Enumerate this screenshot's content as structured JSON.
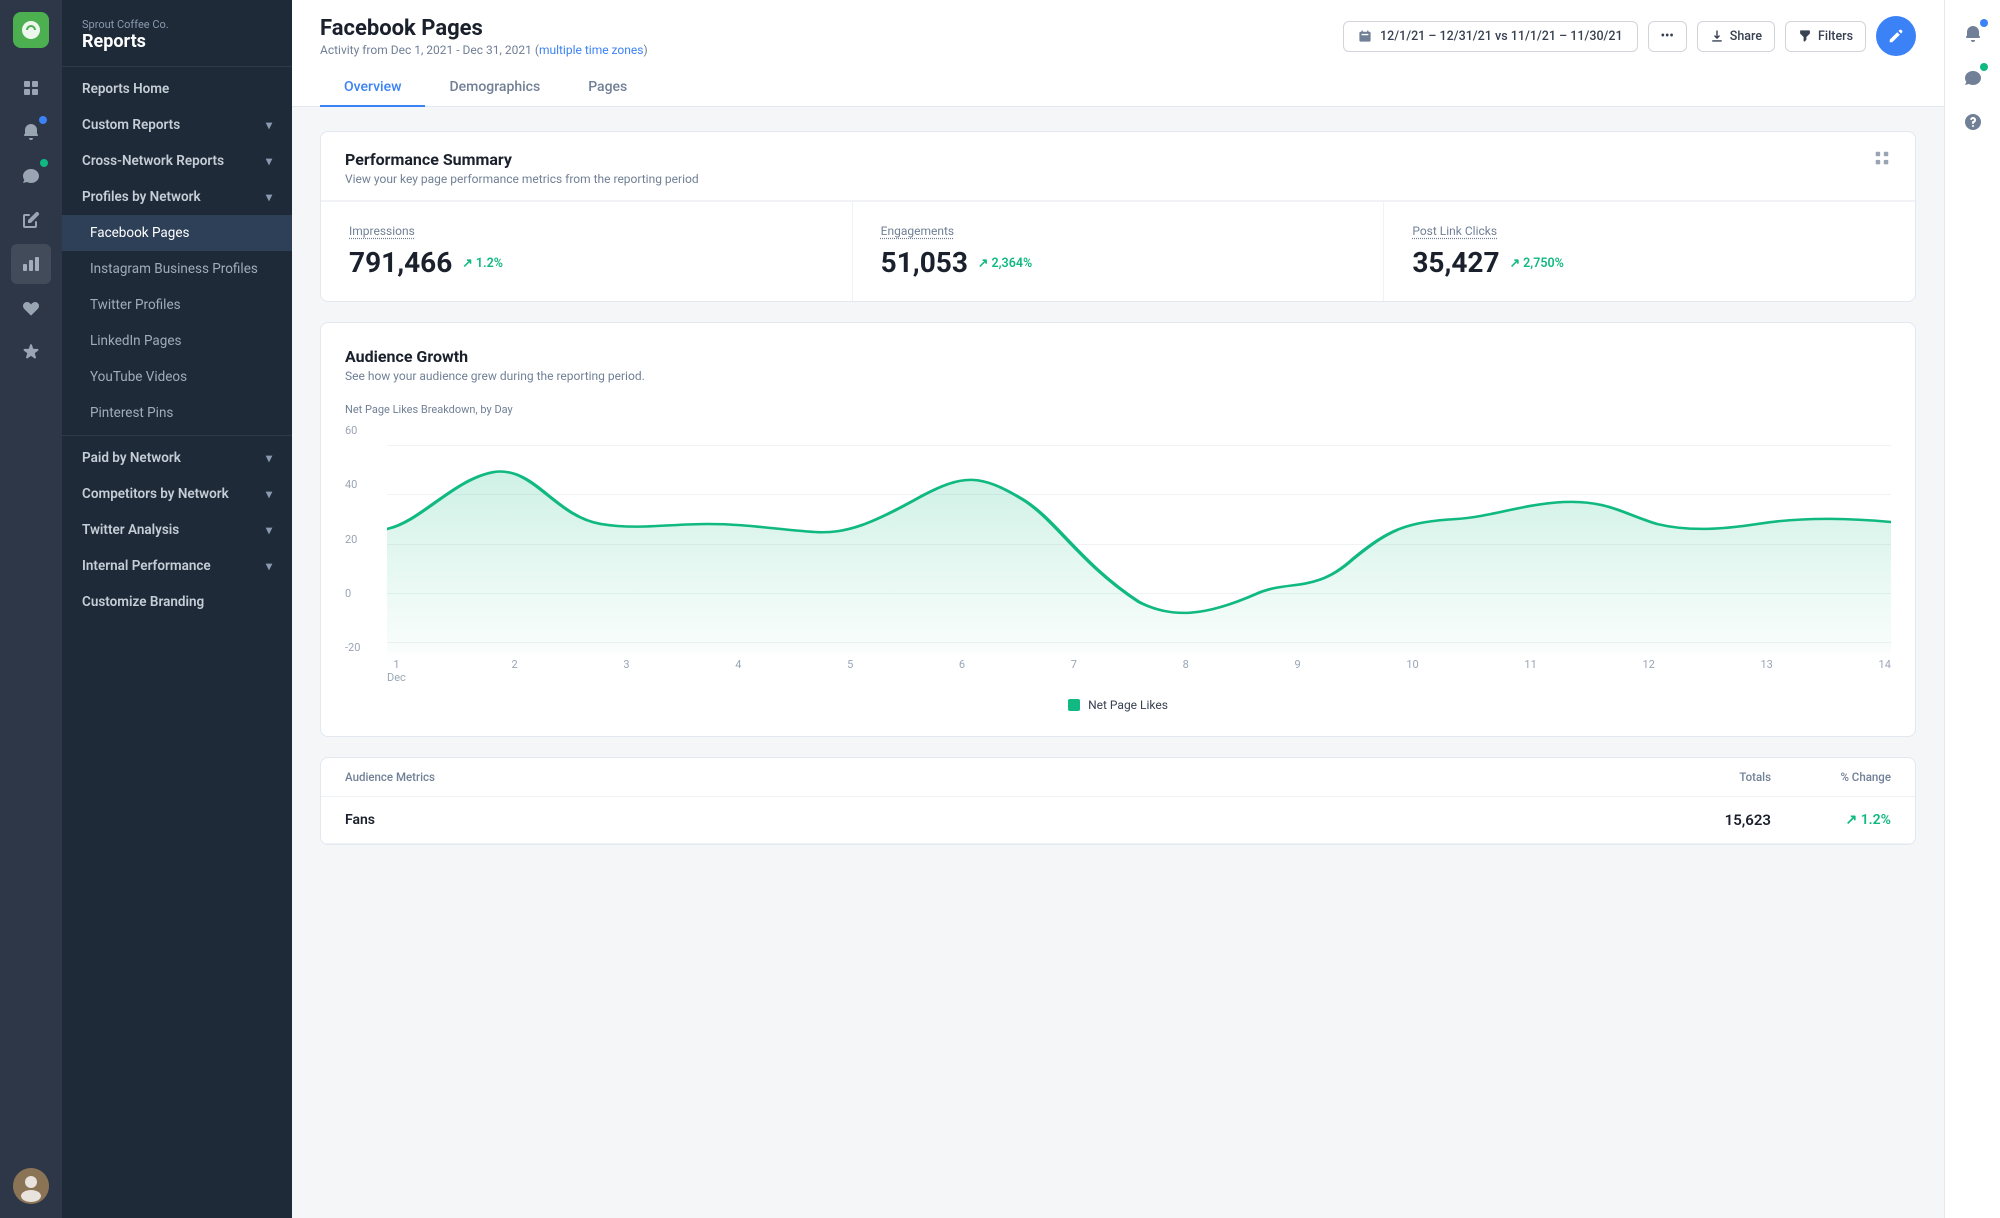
{
  "app": {
    "company": "Sprout Coffee Co.",
    "section": "Reports"
  },
  "sidebar": {
    "nav_items": [
      {
        "id": "reports-home",
        "label": "Reports Home",
        "hasChevron": false,
        "level": "top"
      },
      {
        "id": "custom-reports",
        "label": "Custom Reports",
        "hasChevron": true,
        "level": "top"
      },
      {
        "id": "cross-network-reports",
        "label": "Cross-Network Reports",
        "hasChevron": true,
        "level": "top"
      },
      {
        "id": "profiles-by-network",
        "label": "Profiles by Network",
        "hasChevron": true,
        "level": "top"
      },
      {
        "id": "facebook-pages",
        "label": "Facebook Pages",
        "level": "sub",
        "active": true
      },
      {
        "id": "instagram-business",
        "label": "Instagram Business Profiles",
        "level": "sub"
      },
      {
        "id": "twitter-profiles",
        "label": "Twitter Profiles",
        "level": "sub"
      },
      {
        "id": "linkedin-pages",
        "label": "LinkedIn Pages",
        "level": "sub"
      },
      {
        "id": "youtube-videos",
        "label": "YouTube Videos",
        "level": "sub"
      },
      {
        "id": "pinterest-pins",
        "label": "Pinterest Pins",
        "level": "sub"
      },
      {
        "id": "paid-by-network",
        "label": "Paid by Network",
        "hasChevron": true,
        "level": "top"
      },
      {
        "id": "competitors-by-network",
        "label": "Competitors by Network",
        "hasChevron": true,
        "level": "top"
      },
      {
        "id": "twitter-analysis",
        "label": "Twitter Analysis",
        "hasChevron": true,
        "level": "top"
      },
      {
        "id": "internal-performance",
        "label": "Internal Performance",
        "hasChevron": true,
        "level": "top"
      },
      {
        "id": "customize-branding",
        "label": "Customize Branding",
        "level": "top"
      }
    ]
  },
  "header": {
    "title": "Facebook Pages",
    "subtitle": "Activity from Dec 1, 2021 - Dec 31, 2021",
    "timezone_label": "multiple time zones",
    "date_range": "12/1/21 – 12/31/21 vs 11/1/21 – 11/30/21",
    "share_label": "Share",
    "filters_label": "Filters",
    "tabs": [
      {
        "id": "overview",
        "label": "Overview",
        "active": true
      },
      {
        "id": "demographics",
        "label": "Demographics"
      },
      {
        "id": "pages",
        "label": "Pages"
      }
    ]
  },
  "performance_summary": {
    "title": "Performance Summary",
    "subtitle": "View your key page performance metrics from the reporting period",
    "metrics": [
      {
        "id": "impressions",
        "label": "Impressions",
        "value": "791,466",
        "change": "1.2%",
        "direction": "up"
      },
      {
        "id": "engagements",
        "label": "Engagements",
        "value": "51,053",
        "change": "2,364%",
        "direction": "up"
      },
      {
        "id": "post-link-clicks",
        "label": "Post Link Clicks",
        "value": "35,427",
        "change": "2,750%",
        "direction": "up"
      }
    ]
  },
  "audience_growth": {
    "title": "Audience Growth",
    "subtitle": "See how your audience grew during the reporting period.",
    "chart_label": "Net Page Likes Breakdown, by Day",
    "y_axis": [
      "60",
      "40",
      "20",
      "0",
      "-20"
    ],
    "x_axis": [
      {
        "label": "1",
        "sublabel": "Dec"
      },
      {
        "label": "2"
      },
      {
        "label": "3"
      },
      {
        "label": "4"
      },
      {
        "label": "5"
      },
      {
        "label": "6"
      },
      {
        "label": "7"
      },
      {
        "label": "8"
      },
      {
        "label": "9"
      },
      {
        "label": "10"
      },
      {
        "label": "11"
      },
      {
        "label": "12"
      },
      {
        "label": "13"
      },
      {
        "label": "14"
      }
    ],
    "legend_label": "Net Page Likes",
    "colors": {
      "line": "#10b981",
      "grid": "#f0f2f5"
    }
  },
  "audience_metrics": {
    "title": "Audience Metrics",
    "columns": {
      "main": "Audience Metrics",
      "totals": "Totals",
      "change": "% Change"
    },
    "rows": [
      {
        "label": "Fans",
        "total": "15,623",
        "change": "↑ 1.2%"
      }
    ]
  },
  "icons": {
    "calendar": "📅",
    "share": "↑",
    "filters": "≡",
    "grid": "⊞",
    "bell": "🔔",
    "chat": "💬",
    "help": "?",
    "compose": "✎",
    "chevron_down": "▾"
  },
  "colors": {
    "sidebar_bg": "#1e2a38",
    "sidebar_active": "#2e4058",
    "accent_blue": "#3b82f6",
    "accent_green": "#10b981",
    "logo_green": "#4CAF50",
    "text_dark": "#1a202c",
    "text_gray": "#718096"
  }
}
